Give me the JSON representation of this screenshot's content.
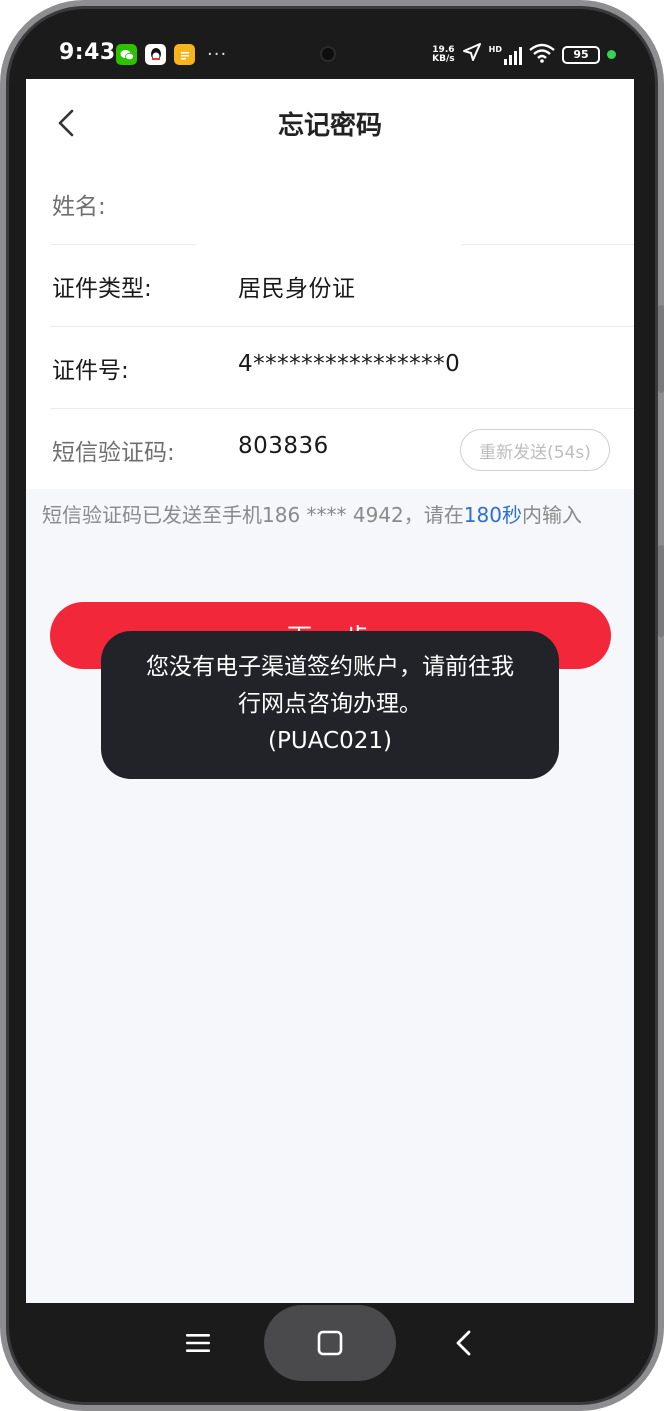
{
  "status_bar": {
    "time": "9:43",
    "more": "···",
    "net_speed_value": "19.6",
    "net_speed_unit": "KB/s",
    "hd": "HD",
    "battery": "95"
  },
  "nav": {
    "title": "忘记密码"
  },
  "form": {
    "name": {
      "label": "姓名:",
      "value": ""
    },
    "id_type": {
      "label": "证件类型:",
      "value": "居民身份证"
    },
    "id_number": {
      "label": "证件号:",
      "value": "4****************0"
    },
    "sms_code": {
      "label": "短信验证码:",
      "value": "803836",
      "resend_label": "重新发送(54s)"
    }
  },
  "hint": {
    "prefix": "短信验证码已发送至手机186 **** 4942，请在",
    "seconds": "180秒",
    "suffix": "内输入"
  },
  "next_button": {
    "label": "下一步"
  },
  "toast": {
    "line1": "您没有电子渠道签约账户，请前往我",
    "line2": "行网点咨询办理。",
    "line3": "(PUAC021)"
  },
  "colors": {
    "primary_red": "#f2283a",
    "link_blue": "#2b6fd1",
    "toast_bg": "#212329"
  }
}
